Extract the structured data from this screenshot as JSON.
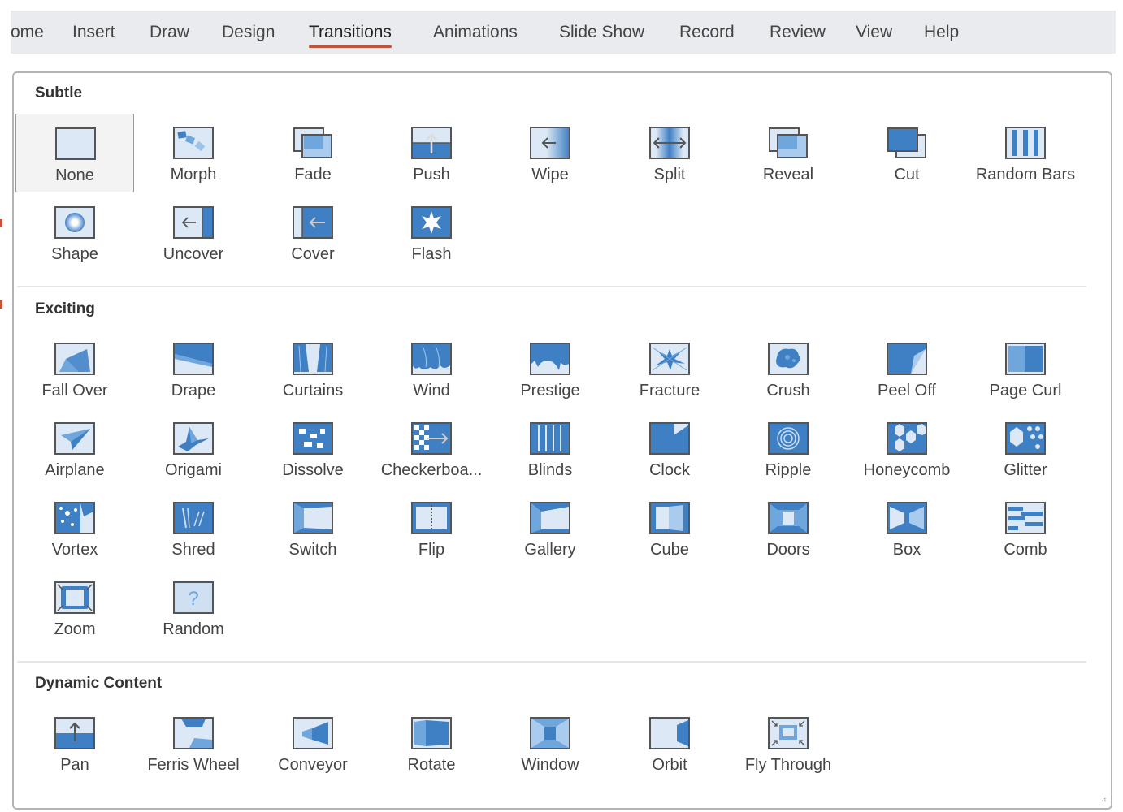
{
  "ribbon": {
    "tabs": [
      {
        "label": "ome",
        "active": false
      },
      {
        "label": "Insert",
        "active": false
      },
      {
        "label": "Draw",
        "active": false
      },
      {
        "label": "Design",
        "active": false
      },
      {
        "label": "Transitions",
        "active": true
      },
      {
        "label": "Animations",
        "active": false
      },
      {
        "label": "Slide Show",
        "active": false
      },
      {
        "label": "Record",
        "active": false
      },
      {
        "label": "Review",
        "active": false
      },
      {
        "label": "View",
        "active": false
      },
      {
        "label": "Help",
        "active": false
      }
    ],
    "accent_color": "#c0543a"
  },
  "gallery": {
    "selected": "None",
    "icon_colors": {
      "dark": "#3f7fc4",
      "mid": "#6fa6dc",
      "light": "#dce8f5",
      "border": "#555555"
    },
    "sections": [
      {
        "title": "Subtle",
        "items": [
          {
            "label": "None",
            "icon": "none-icon"
          },
          {
            "label": "Morph",
            "icon": "morph-icon"
          },
          {
            "label": "Fade",
            "icon": "fade-icon"
          },
          {
            "label": "Push",
            "icon": "push-icon"
          },
          {
            "label": "Wipe",
            "icon": "wipe-icon"
          },
          {
            "label": "Split",
            "icon": "split-icon"
          },
          {
            "label": "Reveal",
            "icon": "reveal-icon"
          },
          {
            "label": "Cut",
            "icon": "cut-icon"
          },
          {
            "label": "Random Bars",
            "icon": "random-bars-icon"
          },
          {
            "label": "Shape",
            "icon": "shape-icon"
          },
          {
            "label": "Uncover",
            "icon": "uncover-icon"
          },
          {
            "label": "Cover",
            "icon": "cover-icon"
          },
          {
            "label": "Flash",
            "icon": "flash-icon"
          }
        ]
      },
      {
        "title": "Exciting",
        "items": [
          {
            "label": "Fall Over",
            "icon": "fall-over-icon"
          },
          {
            "label": "Drape",
            "icon": "drape-icon"
          },
          {
            "label": "Curtains",
            "icon": "curtains-icon"
          },
          {
            "label": "Wind",
            "icon": "wind-icon"
          },
          {
            "label": "Prestige",
            "icon": "prestige-icon"
          },
          {
            "label": "Fracture",
            "icon": "fracture-icon"
          },
          {
            "label": "Crush",
            "icon": "crush-icon"
          },
          {
            "label": "Peel Off",
            "icon": "peel-off-icon"
          },
          {
            "label": "Page Curl",
            "icon": "page-curl-icon"
          },
          {
            "label": "Airplane",
            "icon": "airplane-icon"
          },
          {
            "label": "Origami",
            "icon": "origami-icon"
          },
          {
            "label": "Dissolve",
            "icon": "dissolve-icon"
          },
          {
            "label": "Checkerboa...",
            "icon": "checkerboard-icon"
          },
          {
            "label": "Blinds",
            "icon": "blinds-icon"
          },
          {
            "label": "Clock",
            "icon": "clock-icon"
          },
          {
            "label": "Ripple",
            "icon": "ripple-icon"
          },
          {
            "label": "Honeycomb",
            "icon": "honeycomb-icon"
          },
          {
            "label": "Glitter",
            "icon": "glitter-icon"
          },
          {
            "label": "Vortex",
            "icon": "vortex-icon"
          },
          {
            "label": "Shred",
            "icon": "shred-icon"
          },
          {
            "label": "Switch",
            "icon": "switch-icon"
          },
          {
            "label": "Flip",
            "icon": "flip-icon"
          },
          {
            "label": "Gallery",
            "icon": "gallery-icon"
          },
          {
            "label": "Cube",
            "icon": "cube-icon"
          },
          {
            "label": "Doors",
            "icon": "doors-icon"
          },
          {
            "label": "Box",
            "icon": "box-icon"
          },
          {
            "label": "Comb",
            "icon": "comb-icon"
          },
          {
            "label": "Zoom",
            "icon": "zoom-icon"
          },
          {
            "label": "Random",
            "icon": "random-icon"
          }
        ]
      },
      {
        "title": "Dynamic Content",
        "items": [
          {
            "label": "Pan",
            "icon": "pan-icon"
          },
          {
            "label": "Ferris Wheel",
            "icon": "ferris-wheel-icon"
          },
          {
            "label": "Conveyor",
            "icon": "conveyor-icon"
          },
          {
            "label": "Rotate",
            "icon": "rotate-icon"
          },
          {
            "label": "Window",
            "icon": "window-icon"
          },
          {
            "label": "Orbit",
            "icon": "orbit-icon"
          },
          {
            "label": "Fly Through",
            "icon": "fly-through-icon"
          }
        ]
      }
    ]
  }
}
